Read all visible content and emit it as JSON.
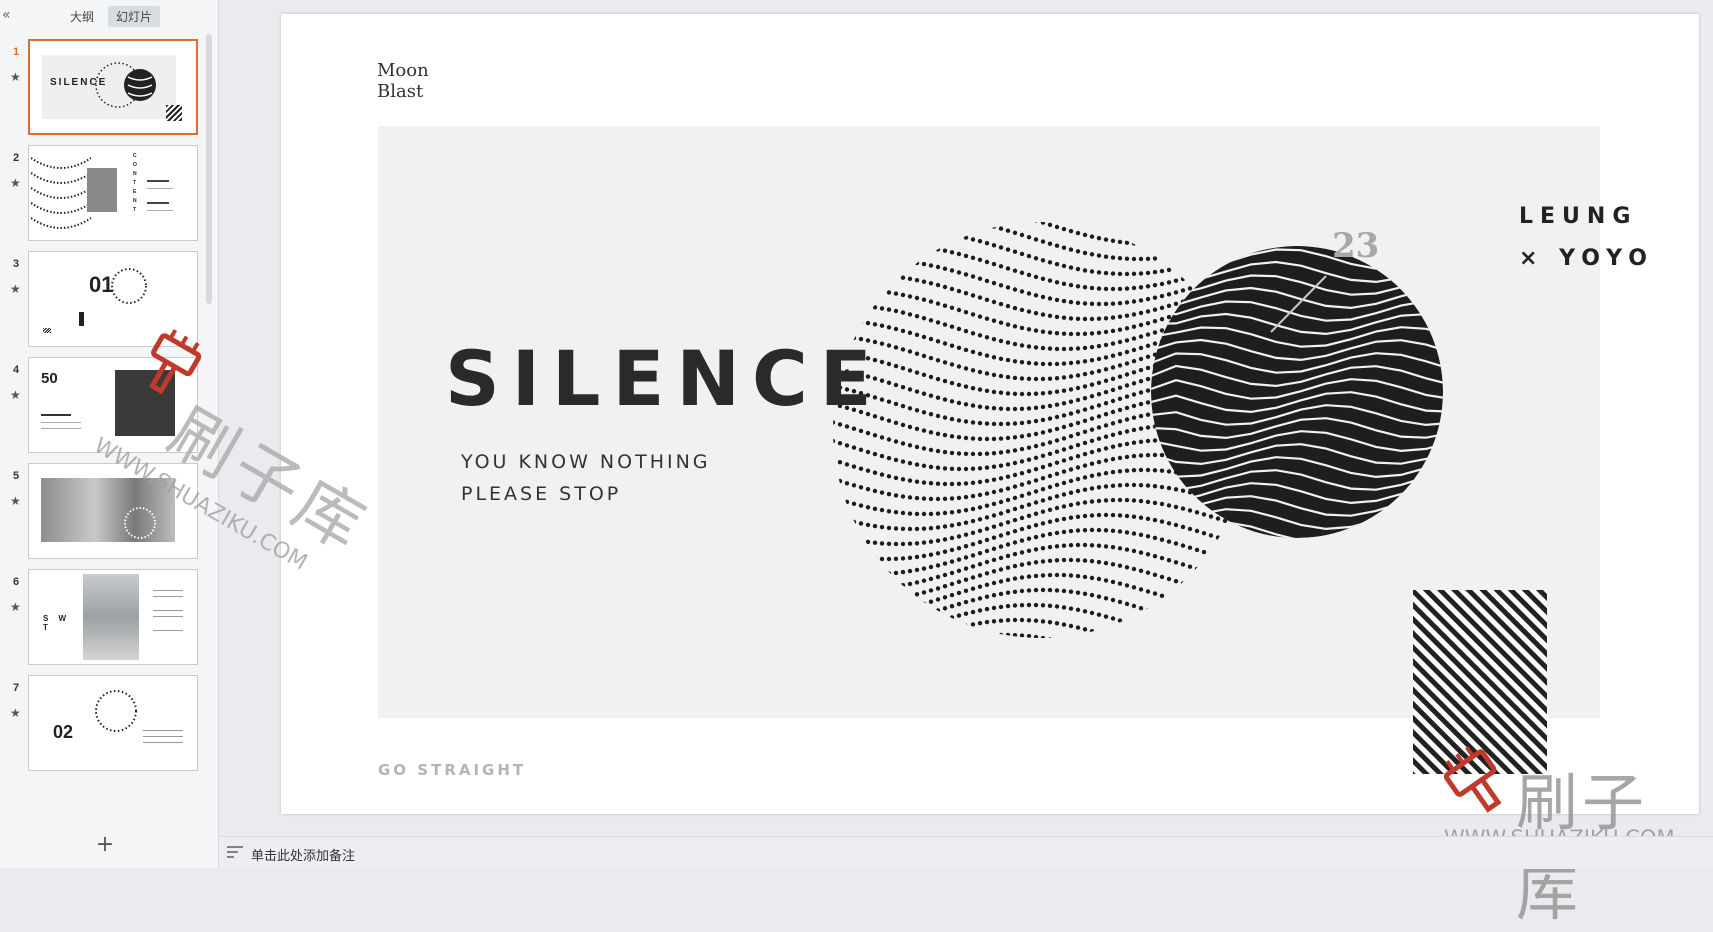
{
  "left_panel": {
    "collapse_icon": "«",
    "tabs": [
      {
        "label": "大纲",
        "active": false
      },
      {
        "label": "幻灯片",
        "active": true
      }
    ],
    "thumbnails": [
      {
        "number": "1",
        "active": true,
        "caption": "SILENCE"
      },
      {
        "number": "2",
        "active": false,
        "caption": "CONTENT"
      },
      {
        "number": "3",
        "active": false,
        "caption": "01"
      },
      {
        "number": "4",
        "active": false,
        "caption": "50"
      },
      {
        "number": "5",
        "active": false,
        "caption": ""
      },
      {
        "number": "6",
        "active": false,
        "caption": "S W T"
      },
      {
        "number": "7",
        "active": false,
        "caption": "02"
      }
    ],
    "star_icon": "★",
    "add_icon": "+"
  },
  "slide": {
    "brand_line1": "Moon",
    "brand_line2": "Blast",
    "title": "SILENCE",
    "subtitle_line1": "YOU KNOW NOTHING",
    "subtitle_line2": "PLEASE STOP",
    "author_line1": "LEUNG",
    "author_line2": "× YOYO",
    "number": "23",
    "footer": "GO STRAIGHT"
  },
  "watermark": {
    "cn": "刷子库",
    "en_center": "WWW.SHUAZIKU.COM",
    "en_corner": "WWW.SHUAZIKU.COM"
  },
  "notes": {
    "placeholder": "单击此处添加备注"
  },
  "colors": {
    "accent": "#e06d2e",
    "brush_red": "#c0392b"
  }
}
